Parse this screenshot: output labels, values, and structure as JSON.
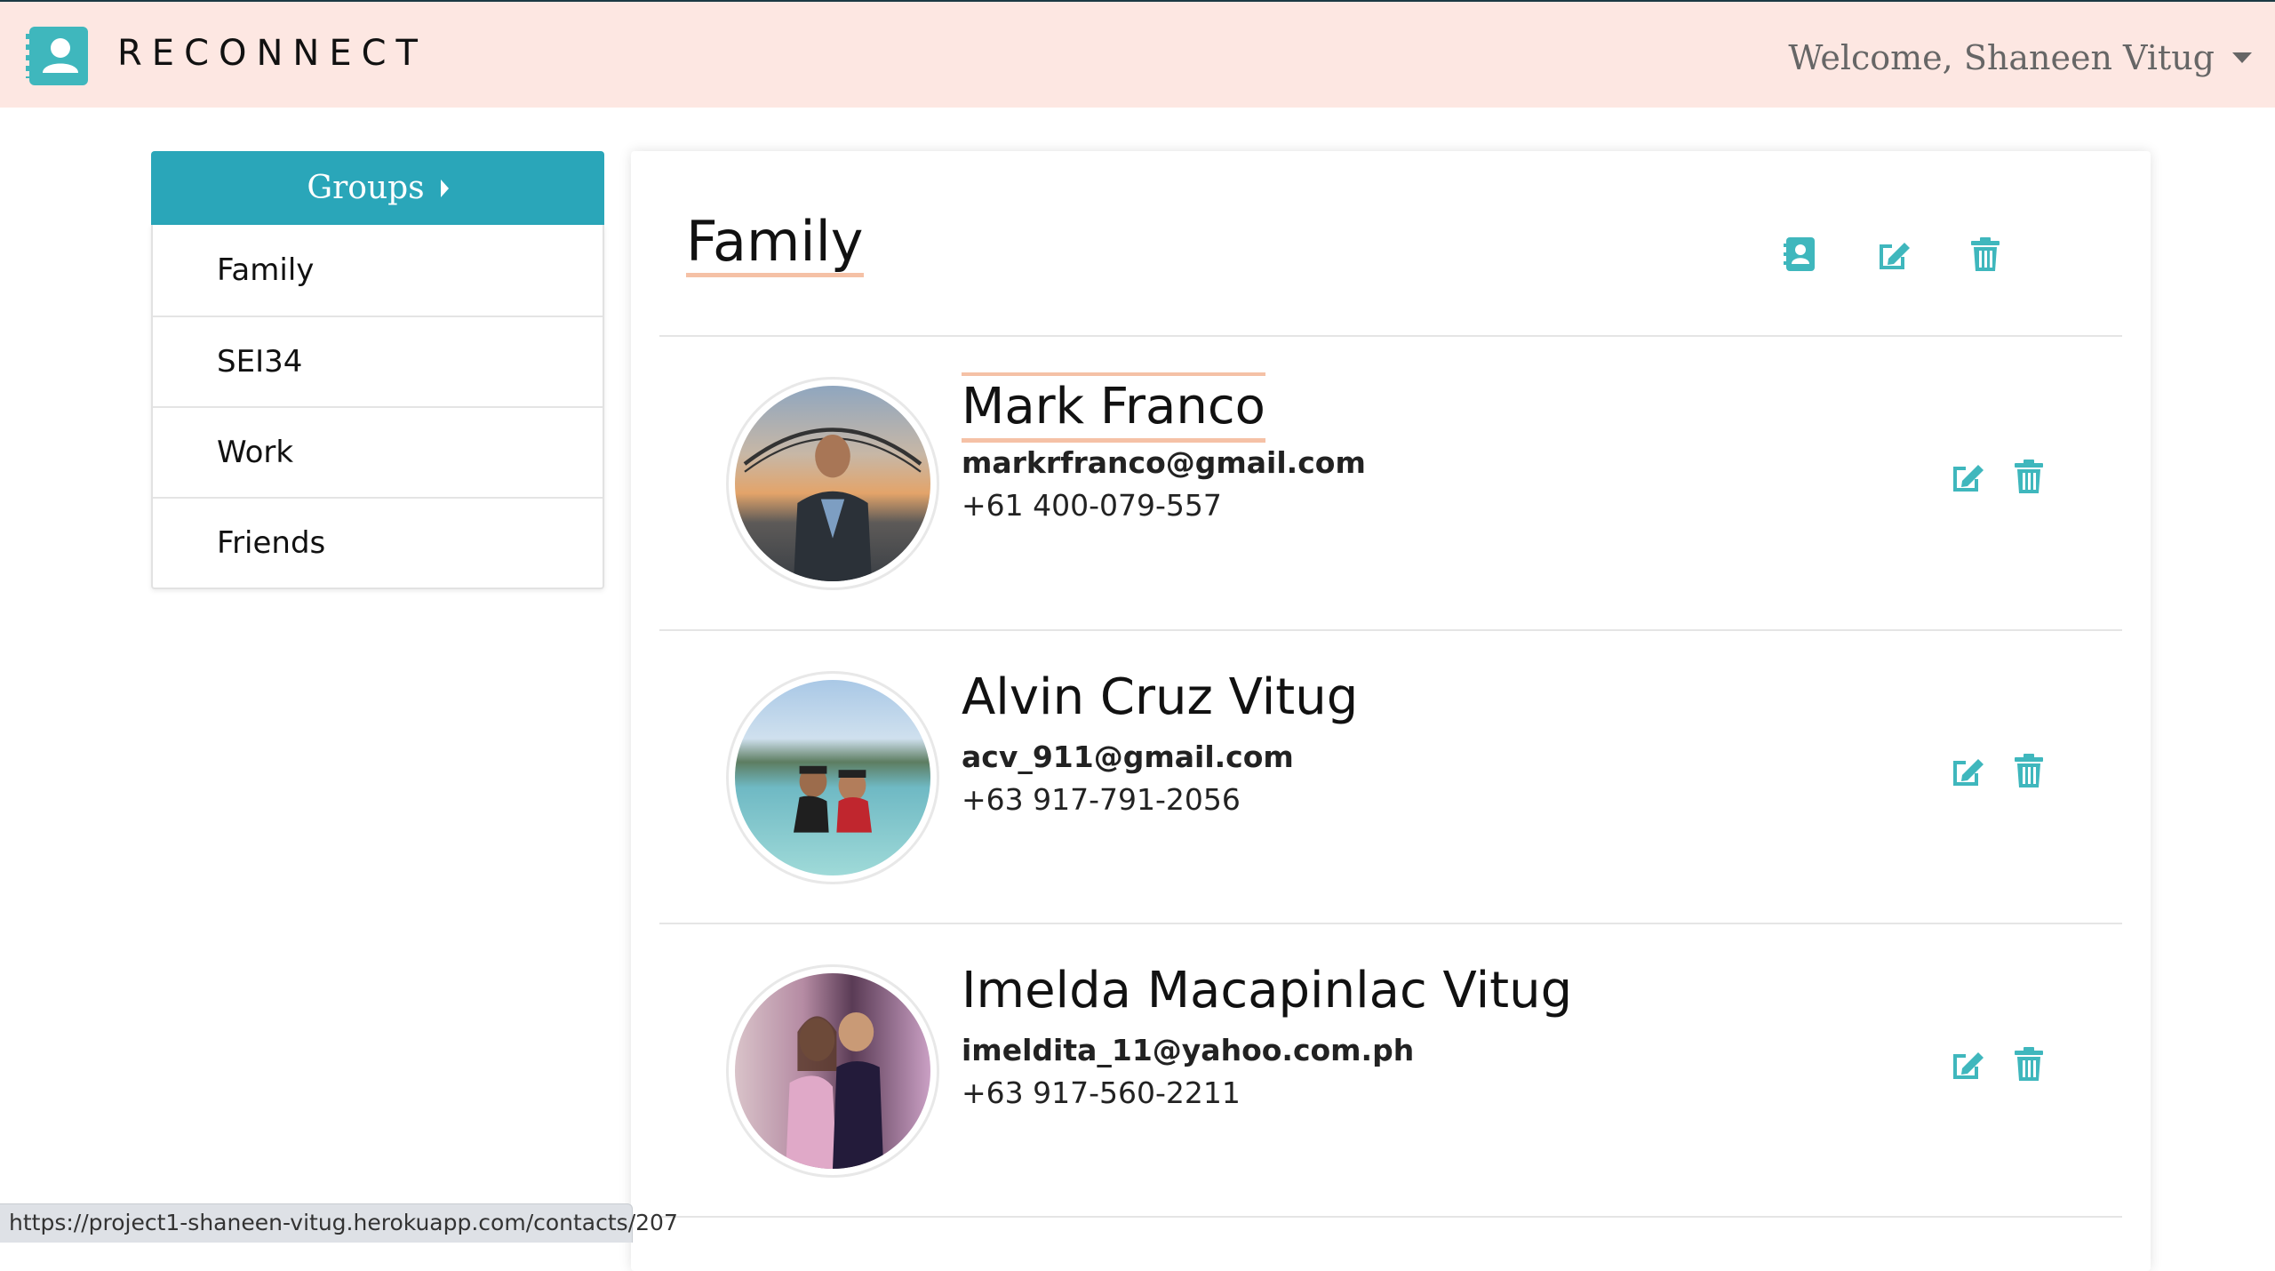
{
  "navbar": {
    "brand": "RECONNECT",
    "welcome": "Welcome, Shaneen Vitug"
  },
  "sidebar": {
    "header": "Groups",
    "groups": [
      "Family",
      "SEI34",
      "Work",
      "Friends"
    ]
  },
  "group": {
    "title": "Family"
  },
  "contacts": [
    {
      "name": "Mark Franco",
      "email": "markrfranco@gmail.com",
      "phone": "+61 400-079-557"
    },
    {
      "name": "Alvin Cruz Vitug",
      "email": "acv_911@gmail.com",
      "phone": "+63 917-791-2056"
    },
    {
      "name": "Imelda Macapinlac Vitug",
      "email": "imeldita_11@yahoo.com.ph",
      "phone": "+63 917-560-2211"
    }
  ],
  "status_url": "https://project1-shaneen-vitug.herokuapp.com/contacts/207",
  "colors": {
    "navbar_bg": "#fde7e2",
    "accent_teal": "#2aa6b9",
    "icon_teal": "#3fb7bd",
    "underline_peach": "#f5c1a6"
  },
  "icons": [
    "contact-book-icon",
    "edit-icon",
    "trash-icon",
    "user-icon",
    "caret-down-icon",
    "caret-right-icon"
  ]
}
